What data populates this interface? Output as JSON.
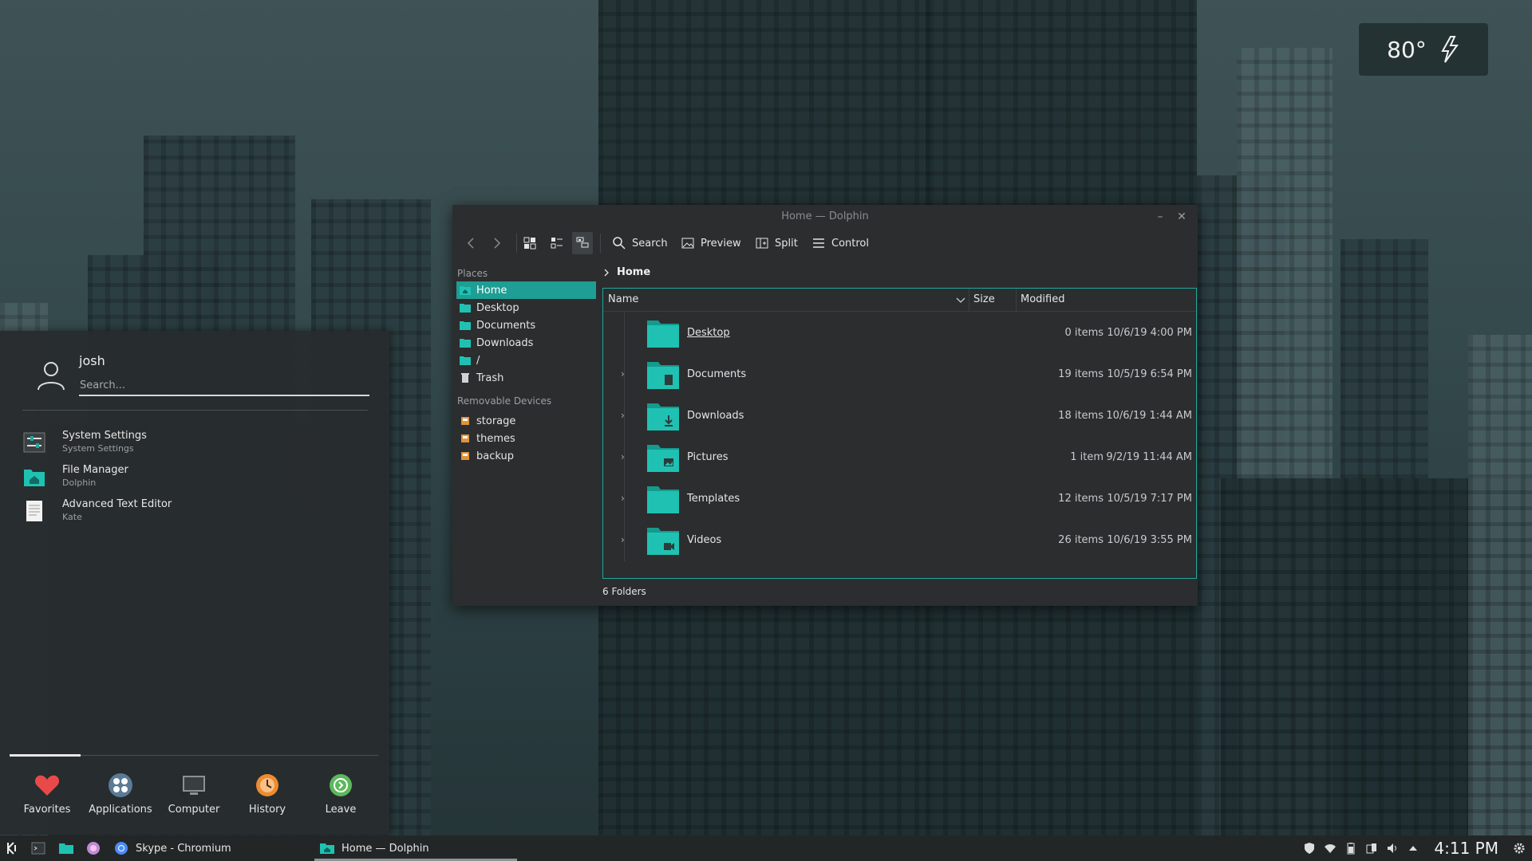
{
  "weather": {
    "temperature": "80°",
    "icon": "lightning-icon"
  },
  "launcher": {
    "user": "josh",
    "search_placeholder": "Search...",
    "favorites": [
      {
        "title": "System Settings",
        "subtitle": "System Settings",
        "icon": "settings-sliders-icon"
      },
      {
        "title": "File Manager",
        "subtitle": "Dolphin",
        "icon": "folder-home-icon"
      },
      {
        "title": "Advanced Text Editor",
        "subtitle": "Kate",
        "icon": "text-document-icon"
      }
    ],
    "tabs": [
      {
        "label": "Favorites",
        "icon": "heart-icon",
        "color": "#e84a4a"
      },
      {
        "label": "Applications",
        "icon": "apps-grid-icon",
        "color": "#7ea4c4"
      },
      {
        "label": "Computer",
        "icon": "monitor-icon",
        "color": "#8c9194"
      },
      {
        "label": "History",
        "icon": "history-icon",
        "color": "#ef8b2e"
      },
      {
        "label": "Leave",
        "icon": "leave-icon",
        "color": "#5cb85c"
      }
    ]
  },
  "dolphin": {
    "title": "Home — Dolphin",
    "toolbar": {
      "search": "Search",
      "preview": "Preview",
      "split": "Split",
      "control": "Control"
    },
    "places_title": "Places",
    "places": [
      "Home",
      "Desktop",
      "Documents",
      "Downloads",
      "/",
      "Trash"
    ],
    "removable_title": "Removable Devices",
    "devices": [
      "storage",
      "themes",
      "backup"
    ],
    "breadcrumb": "Home",
    "columns": {
      "name": "Name",
      "size": "Size",
      "modified": "Modified"
    },
    "rows": [
      {
        "name": "Desktop",
        "size": "0 items",
        "modified": "10/6/19 4:00 PM",
        "expandable": false,
        "emblem": ""
      },
      {
        "name": "Documents",
        "size": "19 items",
        "modified": "10/5/19 6:54 PM",
        "expandable": true,
        "emblem": "doc"
      },
      {
        "name": "Downloads",
        "size": "18 items",
        "modified": "10/6/19 1:44 AM",
        "expandable": true,
        "emblem": "down"
      },
      {
        "name": "Pictures",
        "size": "1 item",
        "modified": "9/2/19 11:44 AM",
        "expandable": true,
        "emblem": "pic"
      },
      {
        "name": "Templates",
        "size": "12 items",
        "modified": "10/5/19 7:17 PM",
        "expandable": true,
        "emblem": ""
      },
      {
        "name": "Videos",
        "size": "26 items",
        "modified": "10/6/19 3:55 PM",
        "expandable": true,
        "emblem": "vid"
      }
    ],
    "status": "6 Folders",
    "accent": "#1fa89c"
  },
  "taskbar": {
    "tasks": [
      {
        "label": "Skype - Chromium",
        "icon": "chromium-icon"
      },
      {
        "label": "Home — Dolphin",
        "icon": "dolphin-icon"
      }
    ],
    "clock": "4:11 PM"
  }
}
